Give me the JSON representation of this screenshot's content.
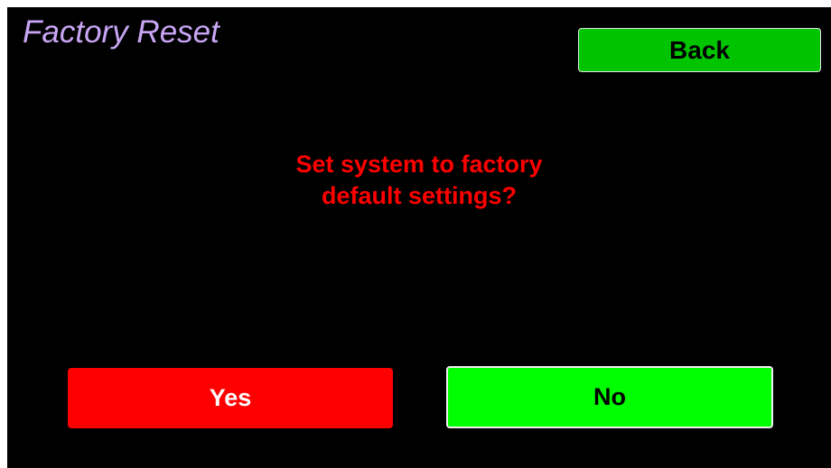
{
  "screen": {
    "title": "Factory Reset",
    "title_color": "#c9a6f5",
    "background_color": "#000000"
  },
  "back_button": {
    "label": "Back",
    "color": "#00c400"
  },
  "message": {
    "line1": "Set system to factory",
    "line2": "default settings?",
    "color": "#ff0000"
  },
  "yes_button": {
    "label": "Yes",
    "color": "#ff0000"
  },
  "no_button": {
    "label": "No",
    "color": "#00ff00"
  }
}
